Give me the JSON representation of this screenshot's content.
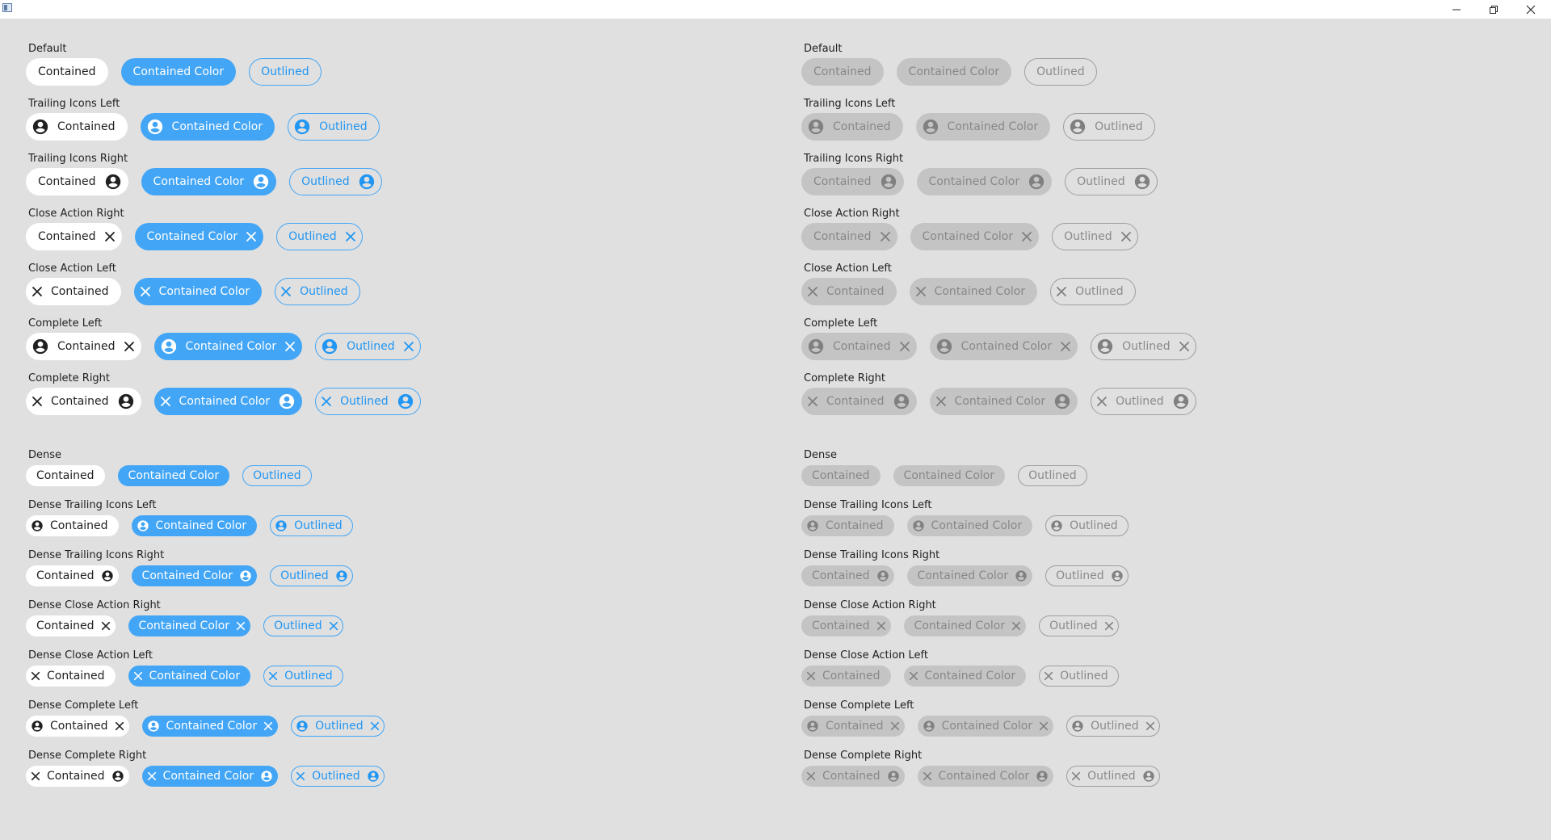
{
  "window": {
    "controls": [
      "minimize",
      "restore",
      "close"
    ]
  },
  "chips": {
    "contained": "Contained",
    "color": "Contained Color",
    "outlined": "Outlined"
  },
  "colors": {
    "accent": "#42a5f5",
    "accent_text": "#2196f3",
    "background": "#e0e0e0",
    "disabled_fill": "#c4c4c4",
    "disabled_text": "#888888"
  },
  "panels": [
    {
      "id": "enabled",
      "state": "enabled"
    },
    {
      "id": "disabled",
      "state": "disabled"
    }
  ],
  "groups": [
    {
      "label": "Default",
      "size": "normal",
      "leading": null,
      "trailing": null
    },
    {
      "label": "Trailing Icons Left",
      "size": "normal",
      "leading": "user",
      "trailing": null
    },
    {
      "label": "Trailing Icons Right",
      "size": "normal",
      "leading": null,
      "trailing": "user"
    },
    {
      "label": "Close Action Right",
      "size": "normal",
      "leading": null,
      "trailing": "close"
    },
    {
      "label": "Close Action Left",
      "size": "normal",
      "leading": "close",
      "trailing": null
    },
    {
      "label": "Complete Left",
      "size": "normal",
      "leading": "user",
      "trailing": "close"
    },
    {
      "label": "Complete Right",
      "size": "normal",
      "leading": "close",
      "trailing": "user"
    },
    {
      "label": "Dense",
      "size": "dense",
      "leading": null,
      "trailing": null
    },
    {
      "label": "Dense Trailing Icons Left",
      "size": "dense",
      "leading": "user",
      "trailing": null
    },
    {
      "label": "Dense Trailing Icons Right",
      "size": "dense",
      "leading": null,
      "trailing": "user"
    },
    {
      "label": "Dense Close Action Right",
      "size": "dense",
      "leading": null,
      "trailing": "close"
    },
    {
      "label": "Dense Close Action Left",
      "size": "dense",
      "leading": "close",
      "trailing": null
    },
    {
      "label": "Dense Complete Left",
      "size": "dense",
      "leading": "user",
      "trailing": "close"
    },
    {
      "label": "Dense Complete Right",
      "size": "dense",
      "leading": "close",
      "trailing": "user"
    }
  ]
}
